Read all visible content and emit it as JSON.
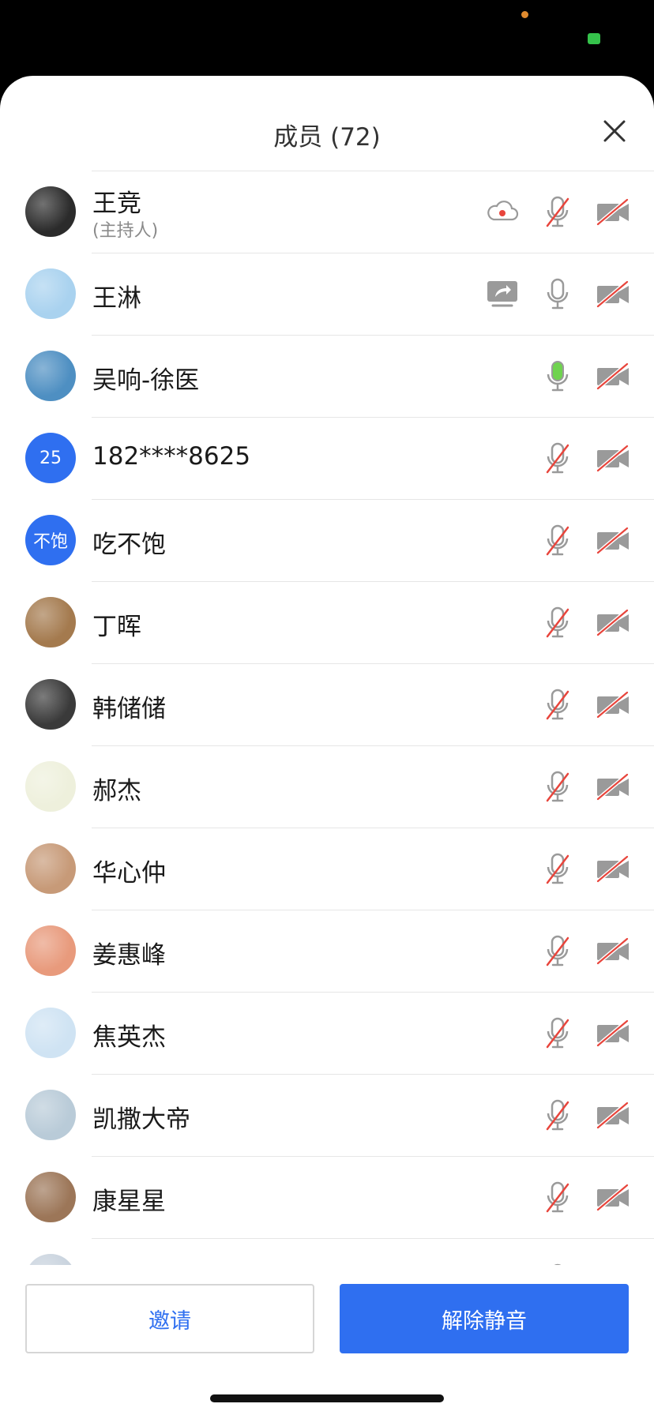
{
  "header": {
    "title": "成员 (72)"
  },
  "members": [
    {
      "name": "王竞",
      "role": "(主持人)",
      "avatar": "photo",
      "avatar_color": "#2b2b2b",
      "recording": true,
      "mic": "muted",
      "camera": "off"
    },
    {
      "name": "王淋",
      "avatar": "photo",
      "avatar_color": "#a9d2ef",
      "sharing": true,
      "mic": "on",
      "camera": "off"
    },
    {
      "name": "吴响-徐医",
      "avatar": "photo",
      "avatar_color": "#4e8fc2",
      "mic": "speaking",
      "camera": "off"
    },
    {
      "name": "182****8625",
      "avatar": "text",
      "avatar_text": "25",
      "avatar_color": "#2f6ff0",
      "mic": "muted",
      "camera": "off"
    },
    {
      "name": "吃不饱",
      "avatar": "text",
      "avatar_text": "不饱",
      "avatar_color": "#2f6ff0",
      "mic": "muted",
      "camera": "off"
    },
    {
      "name": "丁晖",
      "avatar": "photo",
      "avatar_color": "#a47a4e",
      "mic": "muted",
      "camera": "off"
    },
    {
      "name": "韩储储",
      "avatar": "photo",
      "avatar_color": "#3a3a3a",
      "mic": "muted",
      "camera": "off"
    },
    {
      "name": "郝杰",
      "avatar": "photo",
      "avatar_color": "#eef0dc",
      "mic": "muted",
      "camera": "off"
    },
    {
      "name": "华心仲",
      "avatar": "photo",
      "avatar_color": "#c79a78",
      "mic": "muted",
      "camera": "off"
    },
    {
      "name": "姜惠峰",
      "avatar": "photo",
      "avatar_color": "#e89a7c",
      "mic": "muted",
      "camera": "off"
    },
    {
      "name": "焦英杰",
      "avatar": "photo",
      "avatar_color": "#cfe3f3",
      "mic": "muted",
      "camera": "off"
    },
    {
      "name": "凯撒大帝",
      "avatar": "photo",
      "avatar_color": "#b9cbd8",
      "mic": "muted",
      "camera": "off"
    },
    {
      "name": "康星星",
      "avatar": "photo",
      "avatar_color": "#9c7658",
      "mic": "muted",
      "camera": "off"
    },
    {
      "name": "",
      "avatar": "photo",
      "avatar_color": "#c9d3de",
      "mic": "muted",
      "camera": "off"
    }
  ],
  "footer": {
    "invite_label": "邀请",
    "unmute_label": "解除静音"
  },
  "colors": {
    "accent": "#2f6ff0",
    "muted_red": "#e8453c",
    "speaking_green": "#6fd34f",
    "icon_gray": "#9a9a9a"
  },
  "icons": {
    "close": "close-icon",
    "recording": "cloud-record-icon",
    "sharing": "screen-share-icon",
    "mic": "microphone-icon",
    "camera": "camera-off-icon"
  }
}
